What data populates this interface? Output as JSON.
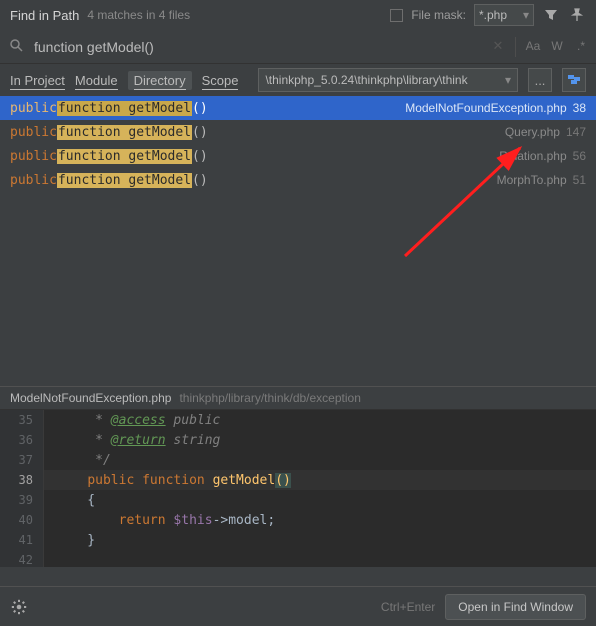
{
  "header": {
    "title": "Find in Path",
    "subtitle": "4 matches in 4 files",
    "file_mask_label": "File mask:",
    "file_mask_value": "*.php"
  },
  "search": {
    "query": "function getModel()",
    "case_label": "Aa",
    "words_label": "W",
    "regex_label": ".*"
  },
  "scope": {
    "tabs": [
      "In Project",
      "Module",
      "Directory",
      "Scope"
    ],
    "selected_index": 2,
    "path": "\\thinkphp_5.0.24\\thinkphp\\library\\think",
    "more_label": "..."
  },
  "results": [
    {
      "kw": "public",
      "hl": "function getModel",
      "rest": "()",
      "file": "ModelNotFoundException.php",
      "line": "38",
      "selected": true
    },
    {
      "kw": "public",
      "hl": "function getModel",
      "rest": "()",
      "file": "Query.php",
      "line": "147",
      "selected": false
    },
    {
      "kw": "public",
      "hl": "function getModel",
      "rest": "()",
      "file": "Relation.php",
      "line": "56",
      "selected": false
    },
    {
      "kw": "public",
      "hl": "function getModel",
      "rest": "()",
      "file": "MorphTo.php",
      "line": "51",
      "selected": false
    }
  ],
  "preview": {
    "file": "ModelNotFoundException.php",
    "path": "thinkphp/library/think/db/exception"
  },
  "code": {
    "l35": {
      "n": "35",
      "a": "     * ",
      "b": "@access",
      "c": " public"
    },
    "l36": {
      "n": "36",
      "a": "     * ",
      "b": "@return",
      "c": " string"
    },
    "l37": {
      "n": "37",
      "a": "     */"
    },
    "l38": {
      "n": "38",
      "indent": "    ",
      "kw1": "public ",
      "kw2": "function ",
      "fn": "getModel",
      "p1": "(",
      "p2": ")"
    },
    "l39": {
      "n": "39",
      "txt": "    {"
    },
    "l40": {
      "n": "40",
      "a": "        ",
      "kw": "return ",
      "var": "$this",
      "rest": "->model;"
    },
    "l41": {
      "n": "41",
      "txt": "    }"
    },
    "l42": {
      "n": "42",
      "txt": ""
    }
  },
  "footer": {
    "hint": "Ctrl+Enter",
    "open_button": "Open in Find Window"
  }
}
